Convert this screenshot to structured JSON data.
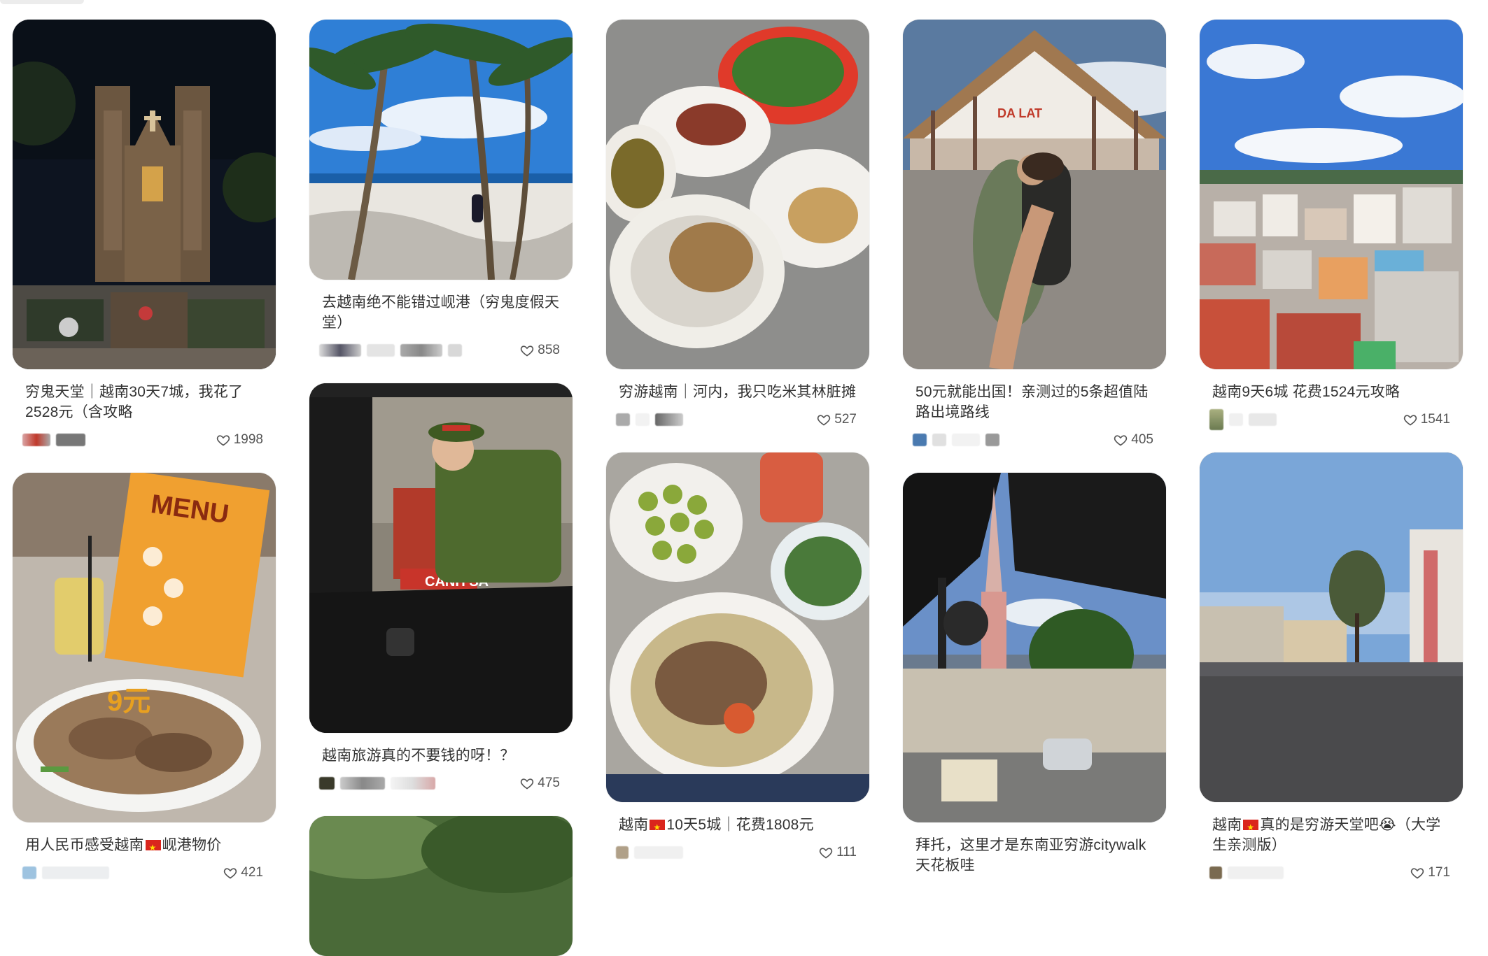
{
  "feed": {
    "cards": [
      {
        "title": "穷鬼天堂｜越南30天7城，我花了2528元（含攻略",
        "likes": "1998"
      },
      {
        "title": "去越南绝不能错过岘港（穷鬼度假天堂）",
        "likes": "858"
      },
      {
        "title": "穷游越南｜河内，我只吃米其林脏摊",
        "likes": "527"
      },
      {
        "title": "50元就能出国！亲测过的5条超值陆路出境路线",
        "likes": "405"
      },
      {
        "title": "越南9天6城 花费1524元攻略",
        "likes": "1541"
      },
      {
        "title_before": "用人民币感受越南",
        "title_after": "岘港物价",
        "likes": "421"
      },
      {
        "title": "越南旅游真的不要钱的呀！？",
        "likes": "475"
      },
      {
        "title_before": "越南",
        "title_after": "10天5城｜花费1808元",
        "likes": "111"
      },
      {
        "title": "拜托，这里才是东南亚穷游citywalk天花板哇",
        "likes": ""
      },
      {
        "title_before": "越南",
        "title_after": "真的是穷游天堂吧😭（大学生亲测版）",
        "likes": "171"
      }
    ],
    "image_text": {
      "menu": "MENU",
      "price_tag": "9元",
      "police_sign": "CANH SA",
      "station_sign": "DA LAT"
    }
  },
  "icons": {
    "like": "heart-outline-icon",
    "flag": "vietnam-flag-icon"
  },
  "colors": {
    "text": "#333333",
    "likes": "#555555",
    "flag_red": "#da251d",
    "flag_star": "#ffde00"
  }
}
